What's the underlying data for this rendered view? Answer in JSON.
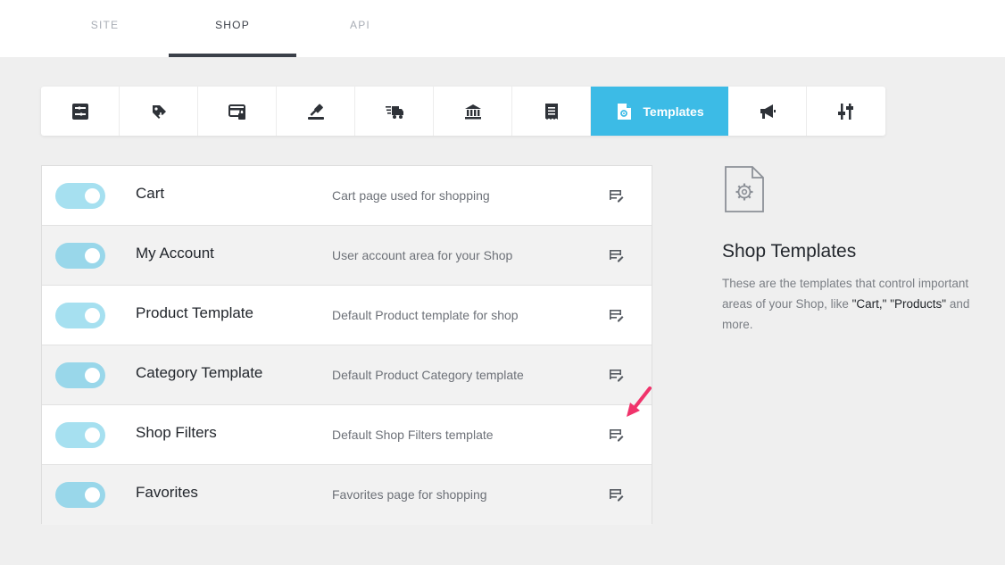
{
  "top_tabs": [
    {
      "label": "SITE",
      "active": false
    },
    {
      "label": "SHOP",
      "active": true
    },
    {
      "label": "API",
      "active": false
    }
  ],
  "toolbar": {
    "items": [
      {
        "icon": "settings-panel-icon"
      },
      {
        "icon": "product-tag-icon"
      },
      {
        "icon": "secure-payment-icon"
      },
      {
        "icon": "auction-gavel-icon"
      },
      {
        "icon": "shipping-truck-icon"
      },
      {
        "icon": "bank-icon"
      },
      {
        "icon": "receipt-icon"
      },
      {
        "icon": "template-file-icon",
        "label": "Templates",
        "active": true
      },
      {
        "icon": "megaphone-icon"
      },
      {
        "icon": "sliders-icon"
      }
    ],
    "active_color": "#3cbbe6"
  },
  "templates": [
    {
      "title": "Cart",
      "description": "Cart page used for shopping",
      "enabled": true
    },
    {
      "title": "My Account",
      "description": "User account area for your Shop",
      "enabled": true
    },
    {
      "title": "Product Template",
      "description": "Default Product template for shop",
      "enabled": true
    },
    {
      "title": "Category Template",
      "description": "Default Product Category template",
      "enabled": true
    },
    {
      "title": "Shop Filters",
      "description": "Default Shop Filters template",
      "enabled": true
    },
    {
      "title": "Favorites",
      "description": "Favorites page for shopping",
      "enabled": true
    }
  ],
  "info_panel": {
    "icon": "template-file-icon",
    "title": "Shop Templates",
    "text_prefix": "These are the templates that control important areas of your Shop, like ",
    "highlight_1": "\"Cart,\"",
    "highlight_2": "\"Products\"",
    "text_suffix": " and more."
  },
  "annotation": {
    "icon": "pointer-arrow-icon",
    "color": "#f0336b"
  }
}
